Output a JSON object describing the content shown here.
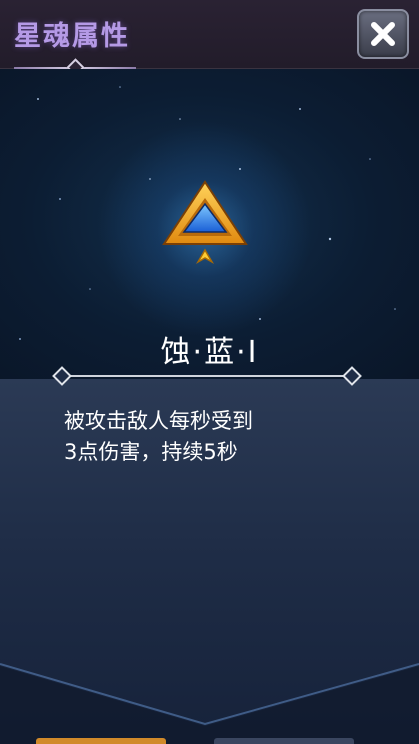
{
  "header": {
    "title": "星魂属性",
    "close_icon": "close-icon"
  },
  "item": {
    "icon": "blue-triangle-soul-emblem",
    "star_count": 1,
    "name": "蚀·蓝·Ⅰ"
  },
  "description": {
    "lines": [
      "被攻击敌人每秒受到",
      "3点伤害，持续5秒"
    ]
  },
  "colors": {
    "title": "#b59ae6",
    "emblem_gold": "#f2a21c",
    "emblem_blue": "#2f8bff",
    "text": "#ffffff"
  }
}
